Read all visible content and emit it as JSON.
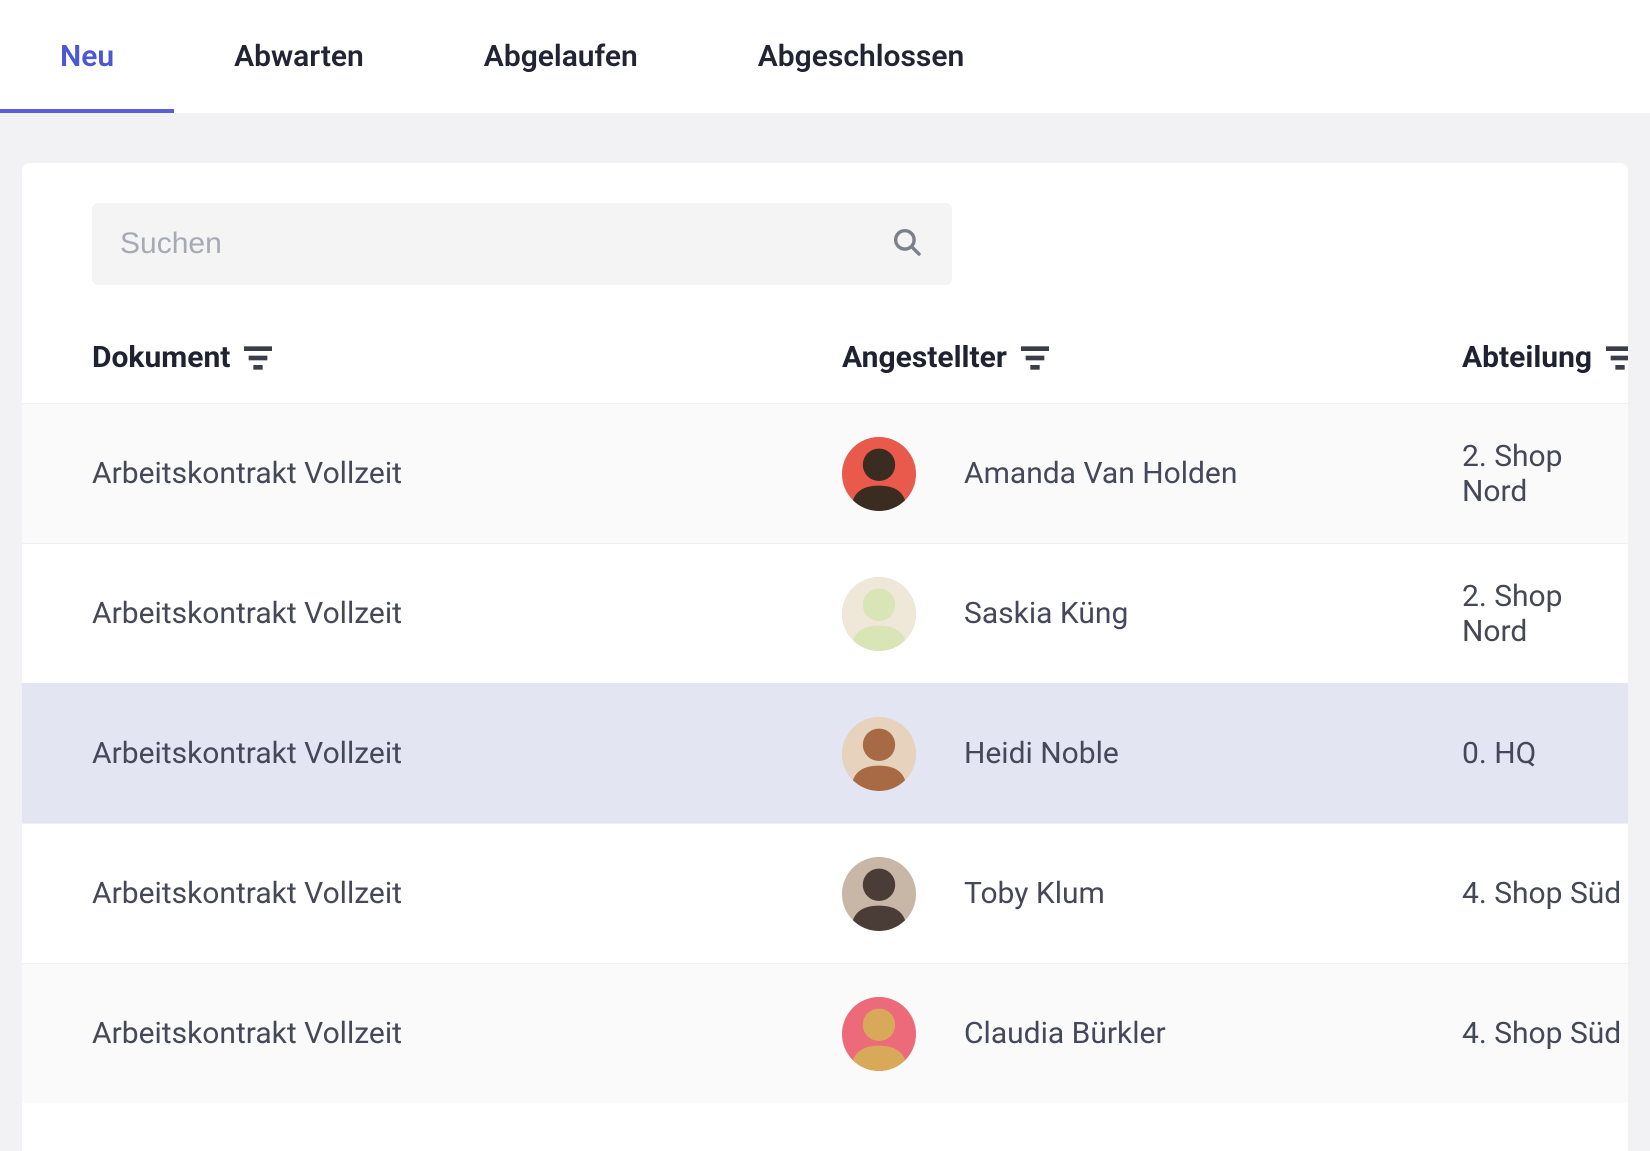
{
  "tabs": [
    {
      "label": "Neu",
      "active": true
    },
    {
      "label": "Abwarten",
      "active": false
    },
    {
      "label": "Abgelaufen",
      "active": false
    },
    {
      "label": "Abgeschlossen",
      "active": false
    }
  ],
  "search": {
    "placeholder": "Suchen",
    "value": ""
  },
  "columns": {
    "document": "Dokument",
    "employee": "Angestellter",
    "department": "Abteilung"
  },
  "rows": [
    {
      "document": "Arbeitskontrakt Vollzeit",
      "employee": "Amanda Van Holden",
      "department": "2. Shop Nord",
      "avatarColors": [
        "#3b2c22",
        "#e9594c"
      ],
      "highlight": false,
      "alt": true
    },
    {
      "document": "Arbeitskontrakt Vollzeit",
      "employee": "Saskia Küng",
      "department": "2. Shop Nord",
      "avatarColors": [
        "#d9e4b7",
        "#efe7d8"
      ],
      "highlight": false,
      "alt": false
    },
    {
      "document": "Arbeitskontrakt Vollzeit",
      "employee": "Heidi Noble",
      "department": "0. HQ",
      "avatarColors": [
        "#a86a45",
        "#e7d2bd"
      ],
      "highlight": true,
      "alt": false
    },
    {
      "document": "Arbeitskontrakt Vollzeit",
      "employee": "Toby Klum",
      "department": "4. Shop Süd",
      "avatarColors": [
        "#4a3c37",
        "#c8b7a7"
      ],
      "highlight": false,
      "alt": false
    },
    {
      "document": "Arbeitskontrakt Vollzeit",
      "employee": "Claudia Bürkler",
      "department": "4. Shop Süd",
      "avatarColors": [
        "#d9a95a",
        "#ec6a7a"
      ],
      "highlight": false,
      "alt": true
    }
  ]
}
